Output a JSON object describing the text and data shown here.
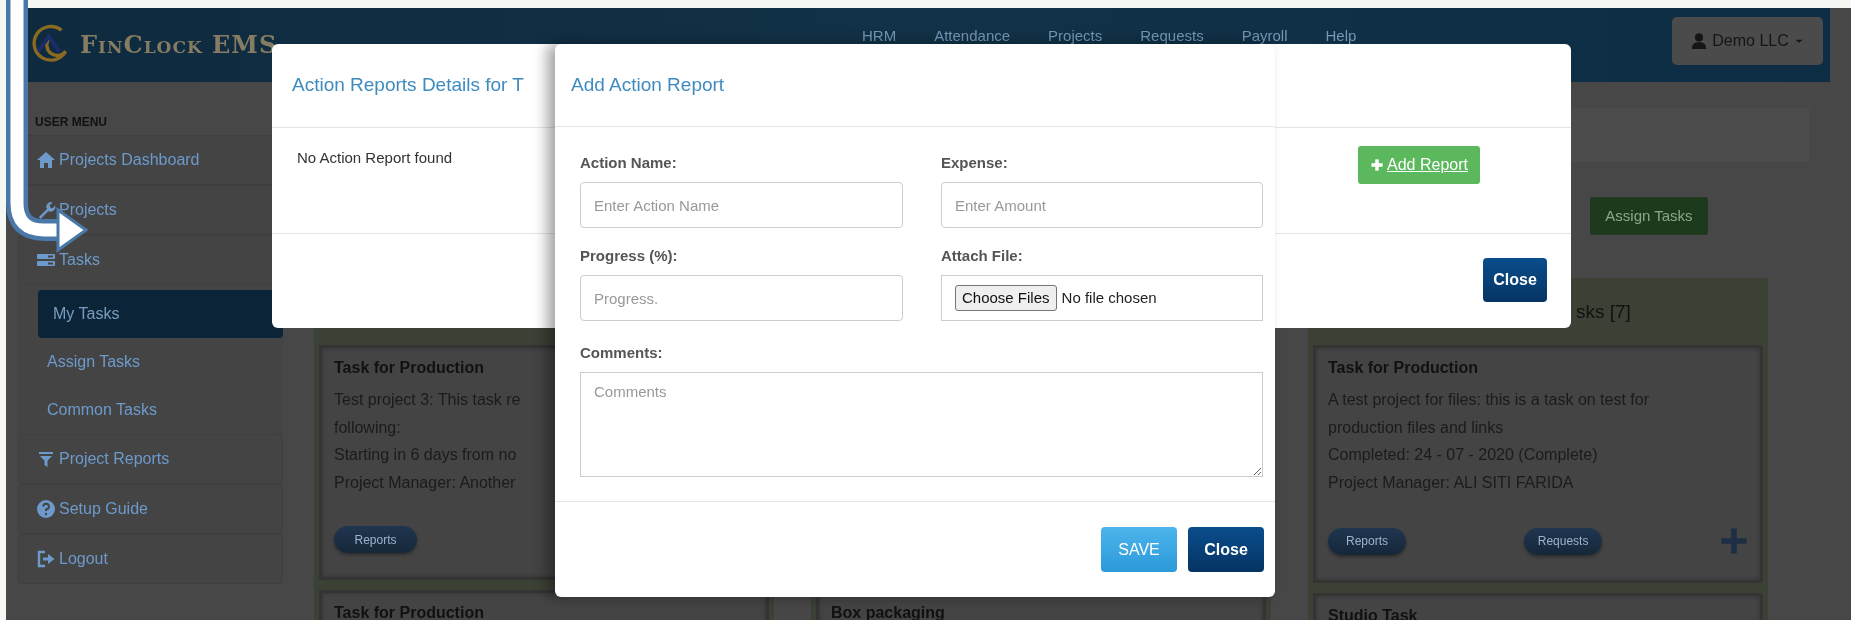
{
  "navbar": {
    "brand": "FinClock EMS",
    "menu": [
      "HRM",
      "Attendance",
      "Projects",
      "Requests",
      "Payroll",
      "Help"
    ],
    "user_button": "Demo LLC"
  },
  "sidebar": {
    "heading": "USER MENU",
    "items": [
      {
        "label": "Projects Dashboard",
        "selected": false
      },
      {
        "label": "Projects",
        "selected": false
      },
      {
        "label": "Tasks",
        "selected": false,
        "children": [
          {
            "label": "My Tasks",
            "selected": true
          },
          {
            "label": "Assign Tasks",
            "selected": false
          },
          {
            "label": "Common Tasks",
            "selected": false
          }
        ]
      },
      {
        "label": "Project Reports",
        "selected": false
      },
      {
        "label": "Setup Guide",
        "selected": false
      },
      {
        "label": "Logout",
        "selected": false
      }
    ]
  },
  "main": {
    "assign_button": "Assign Tasks",
    "columns": [
      {
        "cards": [
          {
            "title": "Task for Production",
            "lines": [
              "Test project 3: This task re",
              "following:",
              "Starting in 6 days from no",
              "Project Manager: Another"
            ],
            "buttons": [
              "Reports"
            ]
          },
          {
            "title": "Task for Production"
          }
        ]
      },
      {
        "cards": [
          {
            "title": "Box packaging"
          }
        ]
      },
      {
        "header": "sks [7]",
        "cards": [
          {
            "title": "Task for Production",
            "lines": [
              "A test project for files: this is a task on test for production files and links",
              "Completed: 24 - 07 - 2020 (Complete)",
              "Project Manager: ALI SITI FARIDA"
            ],
            "buttons": [
              "Reports",
              "Requests"
            ],
            "add_icon": true
          },
          {
            "title": "Studio Task"
          }
        ]
      }
    ]
  },
  "reports_modal": {
    "title": "Action Reports Details for T",
    "empty_text": "No Action Report found",
    "add_button": "Add Report",
    "close_button": "Close"
  },
  "add_modal": {
    "title": "Add Action Report",
    "fields": [
      {
        "kind": "text",
        "label": "Action Name:",
        "placeholder": "Enter Action Name"
      },
      {
        "kind": "text",
        "label": "Expense:",
        "placeholder": "Enter Amount"
      },
      {
        "kind": "text",
        "label": "Progress (%):",
        "placeholder": "Progress."
      },
      {
        "kind": "file",
        "label": "Attach File:",
        "button": "Choose Files",
        "status": "No file chosen"
      },
      {
        "kind": "textarea",
        "label": "Comments:",
        "placeholder": "Comments"
      }
    ],
    "save_button": "SAVE",
    "close_button": "Close"
  }
}
